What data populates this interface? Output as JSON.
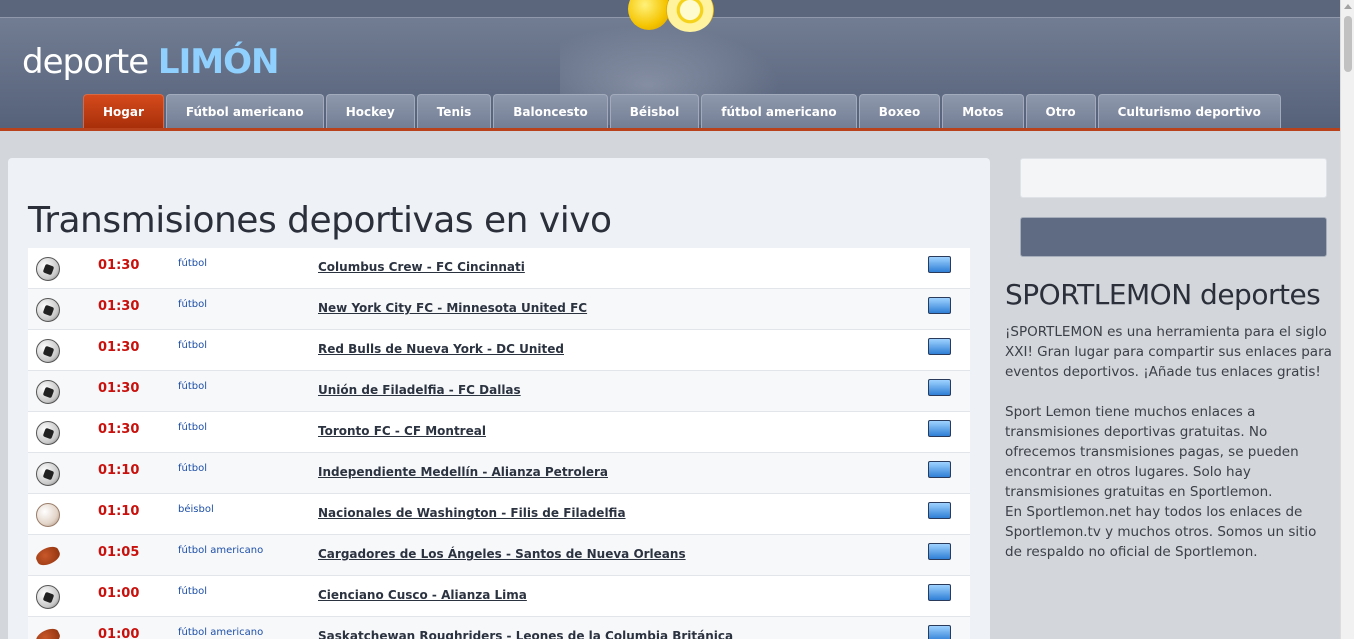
{
  "header": {
    "logo_main": "deporte ",
    "logo_accent": "LIMÓN"
  },
  "nav": {
    "tabs": [
      {
        "label": "Hogar",
        "active": true
      },
      {
        "label": "Fútbol americano"
      },
      {
        "label": "Hockey"
      },
      {
        "label": "Tenis"
      },
      {
        "label": "Baloncesto"
      },
      {
        "label": "Béisbol"
      },
      {
        "label": "fútbol americano"
      },
      {
        "label": "Boxeo"
      },
      {
        "label": "Motos"
      },
      {
        "label": "Otro"
      },
      {
        "label": "Culturismo deportivo"
      }
    ]
  },
  "main": {
    "title": "Transmisiones deportivas en vivo",
    "events": [
      {
        "icon": "soccer-ball-icon",
        "time": "01:30",
        "sport": "fútbol",
        "match": "Columbus Crew - FC Cincinnati"
      },
      {
        "icon": "soccer-ball-icon",
        "time": "01:30",
        "sport": "fútbol",
        "match": "New York City FC - Minnesota United FC"
      },
      {
        "icon": "soccer-ball-icon",
        "time": "01:30",
        "sport": "fútbol",
        "match": "Red Bulls de Nueva York - DC United"
      },
      {
        "icon": "soccer-ball-icon",
        "time": "01:30",
        "sport": "fútbol",
        "match": "Unión de Filadelfia - FC Dallas"
      },
      {
        "icon": "soccer-ball-icon",
        "time": "01:30",
        "sport": "fútbol",
        "match": "Toronto FC - CF Montreal"
      },
      {
        "icon": "soccer-ball-icon",
        "time": "01:10",
        "sport": "fútbol",
        "match": "Independiente Medellín - Alianza Petrolera"
      },
      {
        "icon": "baseball-icon",
        "time": "01:10",
        "sport": "béisbol",
        "match": "Nacionales de Washington - Filis de Filadelfia"
      },
      {
        "icon": "football-icon",
        "time": "01:05",
        "sport": "fútbol americano",
        "match": "Cargadores de Los Ángeles - Santos de Nueva Orleans"
      },
      {
        "icon": "soccer-ball-icon",
        "time": "01:00",
        "sport": "fútbol",
        "match": "Cienciano Cusco - Alianza Lima"
      },
      {
        "icon": "football-icon",
        "time": "01:00",
        "sport": "fútbol americano",
        "match": "Saskatchewan Roughriders - Leones de la Columbia Británica"
      }
    ]
  },
  "sidebar": {
    "title": "SPORTLEMON deportes",
    "paragraphs": [
      "¡SPORTLEMON es una herramienta para el siglo XXI! Gran lugar para compartir sus enlaces para eventos deportivos. ¡Añade tus enlaces gratis!",
      "Sport Lemon tiene muchos enlaces a transmisiones deportivas gratuitas. No ofrecemos transmisiones pagas, se pueden encontrar en otros lugares. Solo hay transmisiones gratuitas en Sportlemon.",
      "En Sportlemon.net hay todos los enlaces de Sportlemon.tv y muchos otros. Somos un sitio de respaldo no oficial de Sportlemon."
    ]
  },
  "colors": {
    "header": "#5f6b82",
    "active_tab": "#c0401a",
    "time": "#c8100c",
    "sport_link": "#1d4fa8"
  }
}
